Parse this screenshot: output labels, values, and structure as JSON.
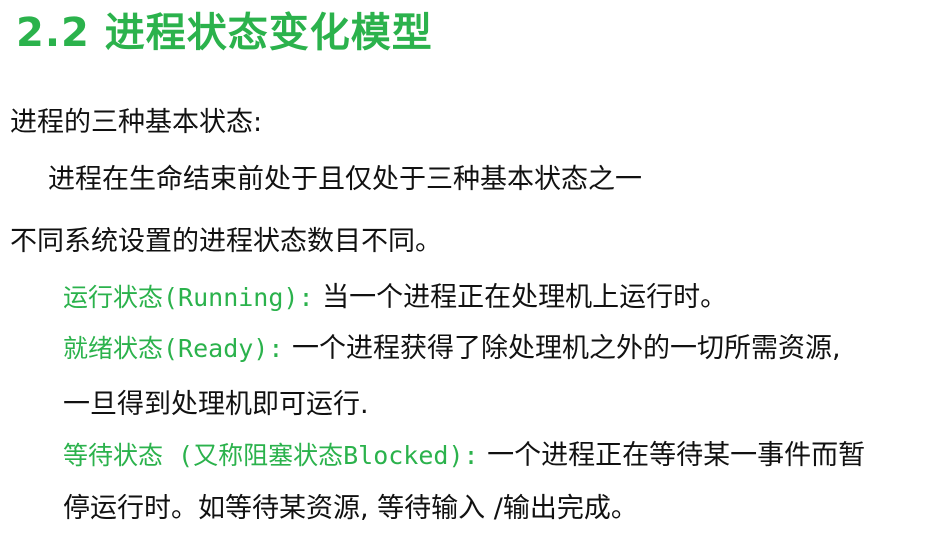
{
  "title": "2.2 进程状态变化模型",
  "intro": "进程的三种基本状态:",
  "indent_line": "进程在生命结束前处于且仅处于三种基本状态之一",
  "note": "不同系统设置的进程状态数目不同。",
  "running": {
    "term": "运行状态(Running):",
    "desc": " 当一个进程正在处理机上运行时。"
  },
  "ready": {
    "term": "就绪状态(Ready):",
    "desc": " 一个进程获得了除处理机之外的一切所需资源,",
    "desc_cont": "一旦得到处理机即可运行."
  },
  "blocked": {
    "term": "等待状态 (又称阻塞状态Blocked):",
    "desc": " 一个进程正在等待某一事件而暂",
    "desc_cont": "停运行时。如等待某资源, 等待输入 /输出完成。"
  },
  "colors": {
    "accent": "#2bb24c",
    "text": "#111111",
    "background": "#ffffff"
  }
}
